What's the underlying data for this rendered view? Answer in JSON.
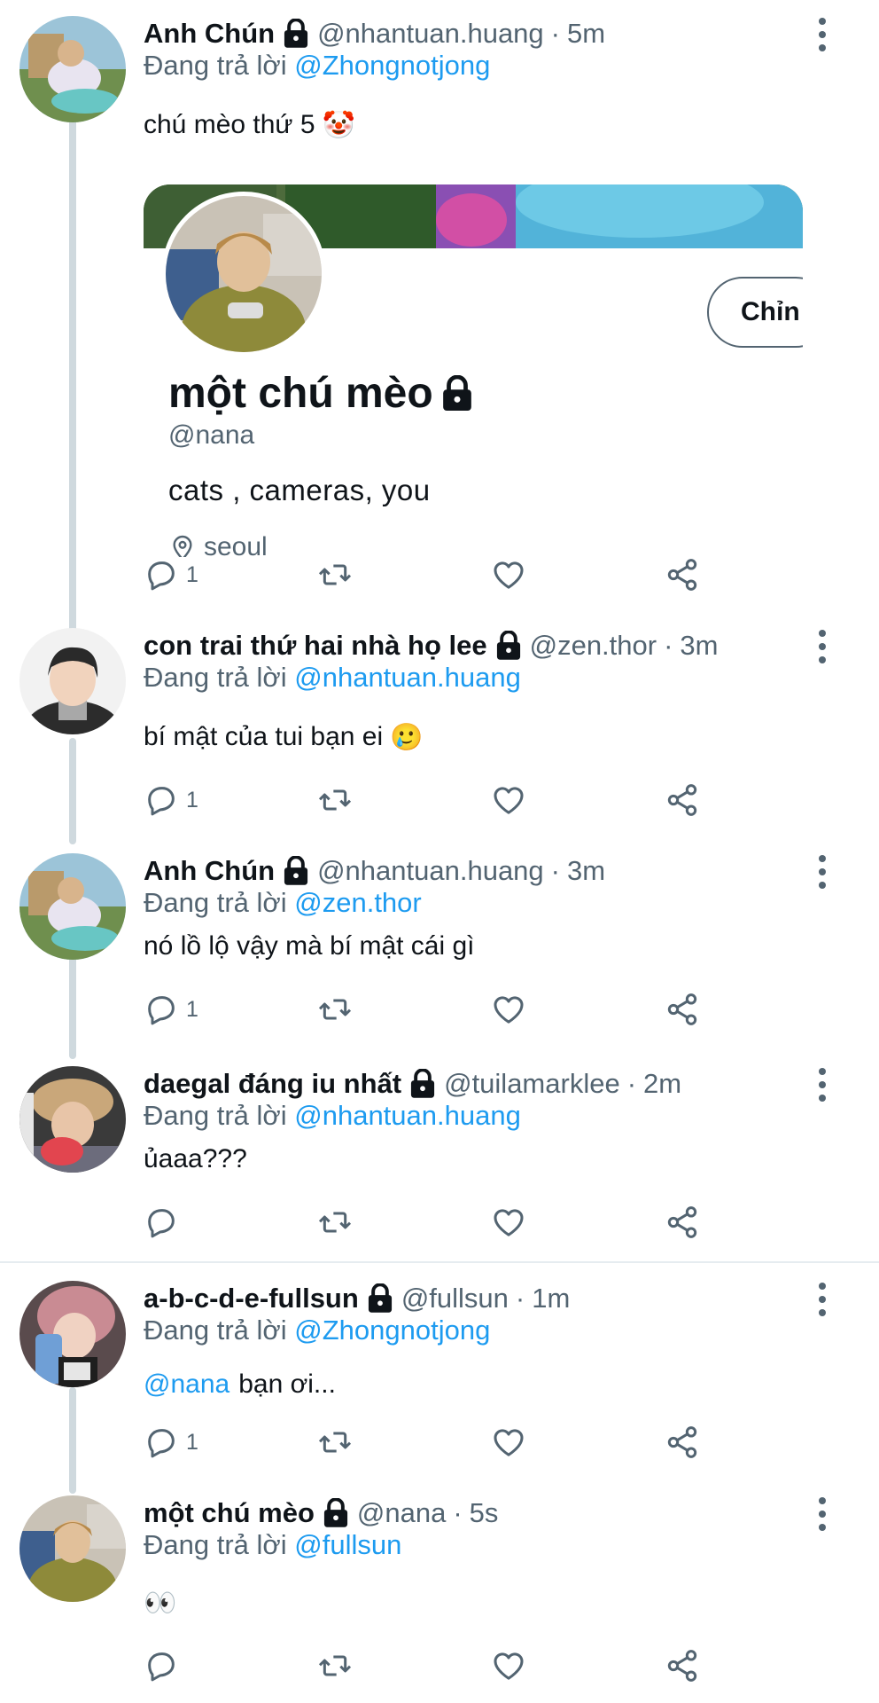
{
  "reply_prefix": "Đang trả lời",
  "colors": {
    "link": "#1d9bf0",
    "muted": "#536471",
    "text": "#0f1419",
    "thread_line": "#cfd9de"
  },
  "icons": {
    "lock": "lock-icon",
    "reply": "reply-icon",
    "retweet": "retweet-icon",
    "like": "heart-icon",
    "share": "share-icon",
    "more": "more-vertical-icon",
    "location": "location-pin-icon"
  },
  "tweets": [
    {
      "name": "Anh Chún",
      "handle": "@nhantuan.huang",
      "time": "5m",
      "reply_to": "@Zhongnotjong",
      "text": "chú mèo thứ 5",
      "emoji": "🤡",
      "reply_count": "1",
      "embed_card": {
        "display_name": "một chú mèo",
        "handle": "@nana",
        "bio": "cats , cameras, you",
        "location": "seoul",
        "button_label": "Chỉn"
      }
    },
    {
      "name": "con trai thứ hai nhà họ lee",
      "handle": "@zen.thor",
      "time": "3m",
      "reply_to": "@nhantuan.huang",
      "text": "bí mật của tui bạn ei",
      "emoji": "🥲",
      "reply_count": "1"
    },
    {
      "name": "Anh Chún",
      "handle": "@nhantuan.huang",
      "time": "3m",
      "reply_to": "@zen.thor",
      "text": "nó lồ lộ vậy mà bí mật cái gì",
      "emoji": "",
      "reply_count": "1"
    },
    {
      "name": "daegal đáng iu nhất",
      "handle": "@tuilamarklee",
      "time": "2m",
      "reply_to": "@nhantuan.huang",
      "text": "ủaaa???",
      "emoji": "",
      "reply_count": ""
    },
    {
      "name": "a-b-c-d-e-fullsun",
      "handle": "@fullsun",
      "time": "1m",
      "reply_to": "@Zhongnotjong",
      "text_mention": "@nana",
      "text": "bạn ơi...",
      "emoji": "",
      "reply_count": "1"
    },
    {
      "name": "một chú mèo",
      "handle": "@nana",
      "time": "5s",
      "reply_to": "@fullsun",
      "text": "",
      "emoji": "👀",
      "reply_count": ""
    }
  ]
}
